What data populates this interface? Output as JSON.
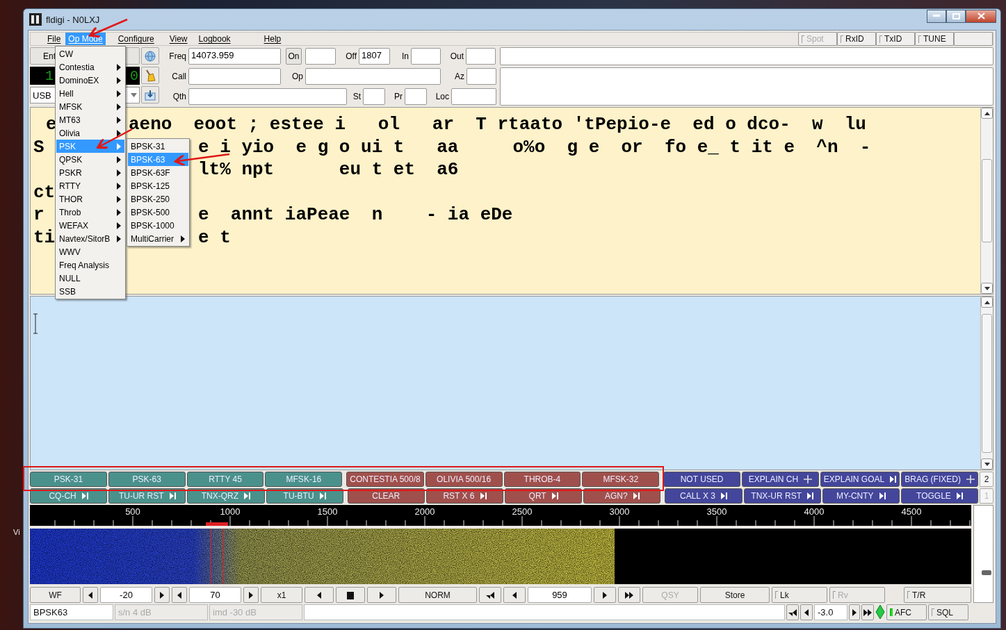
{
  "desktop": {
    "label": "Vi"
  },
  "window": {
    "title": "fldigi - N0LXJ"
  },
  "menubar": {
    "items": [
      {
        "label": "File",
        "selected": false
      },
      {
        "label": "Op Mode",
        "selected": true
      },
      {
        "label": "Configure",
        "selected": false
      },
      {
        "label": "View",
        "selected": false
      },
      {
        "label": "Logbook",
        "selected": false
      },
      {
        "label": "Help",
        "selected": false
      }
    ],
    "toggles": [
      {
        "label": "Spot",
        "checked": false,
        "disabled": true
      },
      {
        "label": "RxID",
        "checked": false,
        "disabled": false
      },
      {
        "label": "TxID",
        "checked": false,
        "disabled": false
      },
      {
        "label": "TUNE",
        "checked": false,
        "disabled": false
      }
    ]
  },
  "op_mode_menu": {
    "items": [
      {
        "label": "CW",
        "submenu": false,
        "selected": false
      },
      {
        "label": "Contestia",
        "submenu": true,
        "selected": false
      },
      {
        "label": "DominoEX",
        "submenu": true,
        "selected": false
      },
      {
        "label": "Hell",
        "submenu": true,
        "selected": false
      },
      {
        "label": "MFSK",
        "submenu": true,
        "selected": false
      },
      {
        "label": "MT63",
        "submenu": true,
        "selected": false
      },
      {
        "label": "Olivia",
        "submenu": true,
        "selected": false
      },
      {
        "label": "PSK",
        "submenu": true,
        "selected": true
      },
      {
        "label": "QPSK",
        "submenu": true,
        "selected": false
      },
      {
        "label": "PSKR",
        "submenu": true,
        "selected": false
      },
      {
        "label": "RTTY",
        "submenu": true,
        "selected": false
      },
      {
        "label": "THOR",
        "submenu": true,
        "selected": false
      },
      {
        "label": "Throb",
        "submenu": true,
        "selected": false
      },
      {
        "label": "WEFAX",
        "submenu": true,
        "selected": false
      },
      {
        "label": "Navtex/SitorB",
        "submenu": true,
        "selected": false
      },
      {
        "label": "WWV",
        "submenu": false,
        "selected": false
      },
      {
        "label": "Freq Analysis",
        "submenu": false,
        "selected": false
      },
      {
        "label": "NULL",
        "submenu": false,
        "selected": false
      },
      {
        "label": "SSB",
        "submenu": false,
        "selected": false
      }
    ]
  },
  "psk_submenu": {
    "items": [
      {
        "label": "BPSK-31",
        "submenu": false,
        "selected": false
      },
      {
        "label": "BPSK-63",
        "submenu": false,
        "selected": true
      },
      {
        "label": "BPSK-63F",
        "submenu": false,
        "selected": false
      },
      {
        "label": "BPSK-125",
        "submenu": false,
        "selected": false
      },
      {
        "label": "BPSK-250",
        "submenu": false,
        "selected": false
      },
      {
        "label": "BPSK-500",
        "submenu": false,
        "selected": false
      },
      {
        "label": "BPSK-1000",
        "submenu": false,
        "selected": false
      },
      {
        "label": "MultiCarrier",
        "submenu": true,
        "selected": false
      }
    ]
  },
  "station": {
    "enter_button": "Ent",
    "frequency_display": [
      "1",
      "0"
    ],
    "mode": "USB"
  },
  "log_rows": [
    [
      {
        "kind": "field",
        "label": "Freq",
        "value": "14073.959"
      },
      {
        "kind": "button",
        "label": "On"
      },
      {
        "kind": "field"
      },
      {
        "kind": "field",
        "label": "Off",
        "value": "1807"
      },
      {
        "kind": "field",
        "label": "In"
      },
      {
        "kind": "field",
        "label": "Out"
      }
    ],
    [
      {
        "kind": "field",
        "label": "Call"
      },
      {
        "kind": "field",
        "label": "Op"
      },
      {
        "kind": "field",
        "label": "Az"
      }
    ],
    [
      {
        "kind": "field",
        "label": "Qth"
      },
      {
        "kind": "field",
        "label": "St"
      },
      {
        "kind": "field",
        "label": "Pr"
      },
      {
        "kind": "field",
        "label": "Loc"
      }
    ]
  ],
  "rx_lines": [
    {
      "left": "e",
      "right": "aeno  eoot ; estee i   ol   ar  T rtaato 'tPepio-e  ed o dco-  w  lu"
    },
    {
      "left": "S",
      "right": "e i yio  e g o ui t   aa     o%o  g e  or  fo e_ t it e  ^n  -"
    },
    {
      "right": "lt% npt      eu t et  a6"
    },
    {
      "left": "ct"
    },
    {
      "left": "r",
      "right": "e  annt iaPeae  n    - ia eDe"
    },
    {
      "left": "ti",
      "right": "e t"
    }
  ],
  "macro_rows": [
    [
      {
        "label": "PSK-31",
        "color": "#4a918c"
      },
      {
        "label": "PSK-63",
        "color": "#4a918c"
      },
      {
        "label": "RTTY 45",
        "color": "#4a918c"
      },
      {
        "label": "MFSK-16",
        "color": "#4a918c"
      },
      {
        "label": "CONTESTIA 500/8",
        "color": "#a0504c"
      },
      {
        "label": "OLIVIA 500/16",
        "color": "#a0504c"
      },
      {
        "label": "THROB-4",
        "color": "#a0504c"
      },
      {
        "label": "MFSK-32",
        "color": "#a0504c"
      },
      {
        "label": "NOT USED",
        "color": "#43469a"
      },
      {
        "label": "EXPLAIN CH",
        "color": "#43469a",
        "kind": "plus"
      },
      {
        "label": "EXPLAIN GOAL",
        "color": "#43469a",
        "kind": "next"
      },
      {
        "label": "BRAG (FIXED)",
        "color": "#43469a",
        "kind": "plus"
      }
    ],
    [
      {
        "label": "CQ-CH",
        "color": "#4a918c",
        "kind": "next"
      },
      {
        "label": "TU-UR RST",
        "color": "#4a918c",
        "kind": "next"
      },
      {
        "label": "TNX-QRZ",
        "color": "#4a918c",
        "kind": "next"
      },
      {
        "label": "TU-BTU",
        "color": "#4a918c",
        "kind": "next"
      },
      {
        "label": "CLEAR",
        "color": "#a0504c"
      },
      {
        "label": "RST X 6",
        "color": "#a0504c",
        "kind": "next"
      },
      {
        "label": "QRT",
        "color": "#a0504c",
        "kind": "next"
      },
      {
        "label": "AGN?",
        "color": "#a0504c",
        "kind": "next"
      },
      {
        "label": "CALL X 3",
        "color": "#43469a",
        "kind": "next"
      },
      {
        "label": "TNX-UR RST",
        "color": "#43469a",
        "kind": "next"
      },
      {
        "label": "MY-CNTY",
        "color": "#43469a",
        "kind": "next"
      },
      {
        "label": "TOGGLE",
        "color": "#43469a",
        "kind": "next"
      }
    ]
  ],
  "macro_banks": [
    {
      "label": "2",
      "disabled": false
    },
    {
      "label": "1",
      "disabled": true
    }
  ],
  "scale_labels": [
    "500",
    "1000",
    "1500",
    "2000",
    "2500",
    "3000",
    "3500",
    "4000",
    "4500"
  ],
  "signal_slider": {
    "level": 0.33
  },
  "controls": [
    {
      "kind": "button",
      "label": "WF"
    },
    {
      "kind": "left"
    },
    {
      "kind": "field",
      "value": "-20"
    },
    {
      "kind": "right"
    },
    {
      "kind": "left"
    },
    {
      "kind": "field",
      "value": "70"
    },
    {
      "kind": "right"
    },
    {
      "kind": "button",
      "label": "x1"
    },
    {
      "kind": "left"
    },
    {
      "kind": "stop"
    },
    {
      "kind": "right"
    },
    {
      "kind": "button",
      "label": "NORM"
    },
    {
      "kind": "rewind"
    },
    {
      "kind": "left"
    },
    {
      "kind": "field",
      "value": "959"
    },
    {
      "kind": "right"
    },
    {
      "kind": "ffwd"
    },
    {
      "kind": "button",
      "label": "QSY",
      "disabled": true
    },
    {
      "kind": "button",
      "label": "Store"
    },
    {
      "kind": "check",
      "label": "Lk",
      "checked": false
    },
    {
      "kind": "check",
      "label": "Rv",
      "checked": false,
      "disabled": true
    },
    {
      "kind": "check",
      "label": "T/R",
      "checked": false
    }
  ],
  "status": [
    {
      "kind": "field",
      "value": "BPSK63"
    },
    {
      "kind": "readout",
      "value": "s/n  4 dB"
    },
    {
      "kind": "readout",
      "value": "imd -30 dB"
    },
    {
      "kind": "blank"
    },
    {
      "kind": "rewind"
    },
    {
      "kind": "left"
    },
    {
      "kind": "field",
      "value": "-3.0"
    },
    {
      "kind": "right"
    },
    {
      "kind": "ffwd"
    },
    {
      "kind": "diamond"
    },
    {
      "kind": "check",
      "label": "AFC",
      "checked": true
    },
    {
      "kind": "check",
      "label": "SQL",
      "checked": false
    }
  ]
}
